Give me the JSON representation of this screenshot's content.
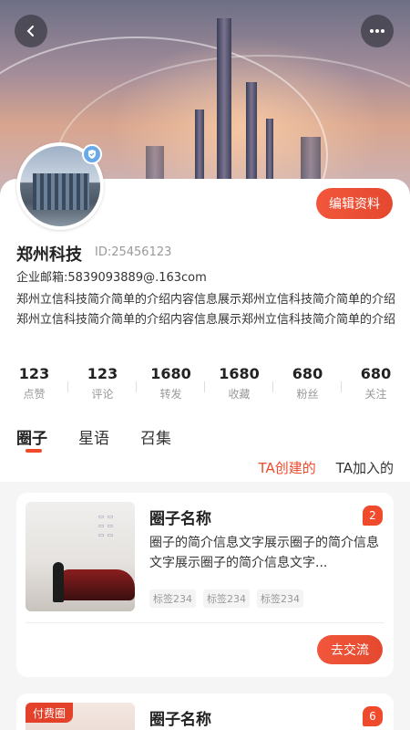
{
  "header": {
    "back_icon": "chevron-left-icon",
    "more_icon": "more-dots-icon"
  },
  "profile": {
    "name": "郑州科技",
    "id": "ID:25456123",
    "email": "企业邮箱:5839093889@.163com",
    "description": "郑州立信科技简介简单的介绍内容信息展示郑州立信科技简介简单的介绍郑州立信科技简介简单的介绍内容信息展示郑州立信科技简介简单的介绍",
    "edit_label": "编辑资料",
    "badge_icon": "verified-shield-icon"
  },
  "stats": [
    {
      "value": "123",
      "label": "点赞"
    },
    {
      "value": "123",
      "label": "评论"
    },
    {
      "value": "1680",
      "label": "转发"
    },
    {
      "value": "1680",
      "label": "收藏"
    },
    {
      "value": "680",
      "label": "粉丝"
    },
    {
      "value": "680",
      "label": "关注"
    }
  ],
  "tabs": [
    {
      "label": "圈子",
      "active": true
    },
    {
      "label": "星语",
      "active": false
    },
    {
      "label": "召集",
      "active": false
    }
  ],
  "subtabs": [
    {
      "label": "TA创建的",
      "active": true
    },
    {
      "label": "TA加入的",
      "active": false
    }
  ],
  "cards": [
    {
      "title": "圈子名称",
      "count": "2",
      "description": "圈子的简介信息文字展示圈子的简介信息文字展示圈子的简介信息文字...",
      "tags": [
        "标签234",
        "标签234",
        "标签234"
      ],
      "action_label": "去交流"
    },
    {
      "title": "圈子名称",
      "count": "6",
      "paid_label": "付费圈"
    }
  ],
  "colors": {
    "accent": "#f04a2d",
    "button": "#e4492f"
  }
}
